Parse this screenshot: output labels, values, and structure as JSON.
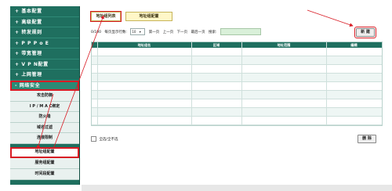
{
  "sidebar": {
    "items": [
      {
        "label": "+ 基本配置"
      },
      {
        "label": "+ 高级配置"
      },
      {
        "label": "+ 转发规则"
      },
      {
        "label": "+ P P P o E"
      },
      {
        "label": "+ 带宽管理"
      },
      {
        "label": "+ V P N配置"
      },
      {
        "label": "+ 上网管理"
      },
      {
        "label": "- 网络安全"
      }
    ],
    "sub_items": [
      {
        "label": "攻击防御"
      },
      {
        "label": "I P / M A C绑定"
      },
      {
        "label": "防火墙"
      },
      {
        "label": "域名过滤"
      },
      {
        "label": "连接限制"
      },
      {
        "label": "地址组配置"
      },
      {
        "label": "服务组配置"
      },
      {
        "label": "时间段配置"
      }
    ]
  },
  "tabs": [
    {
      "label": "地址组列表"
    },
    {
      "label": "地址组配置"
    }
  ],
  "toolbar": {
    "count": "0/100",
    "per_page_label": "每页显示行数:",
    "per_page_value": "10",
    "first": "第一页",
    "prev": "上一页",
    "next": "下一页",
    "last": "最后一页",
    "search_label": "搜索:"
  },
  "buttons": {
    "new": "新 建",
    "delete": "删 除"
  },
  "table": {
    "headers": [
      "地址组名",
      "区域",
      "地址范围",
      "编辑"
    ],
    "rows": 9
  },
  "select_all_label": "全选/全不选",
  "colors": {
    "sidebar": "#1f6f5f",
    "highlight": "#d81b24",
    "tab_bg": "#fff7c8",
    "search_bg": "#d9f0d9"
  }
}
